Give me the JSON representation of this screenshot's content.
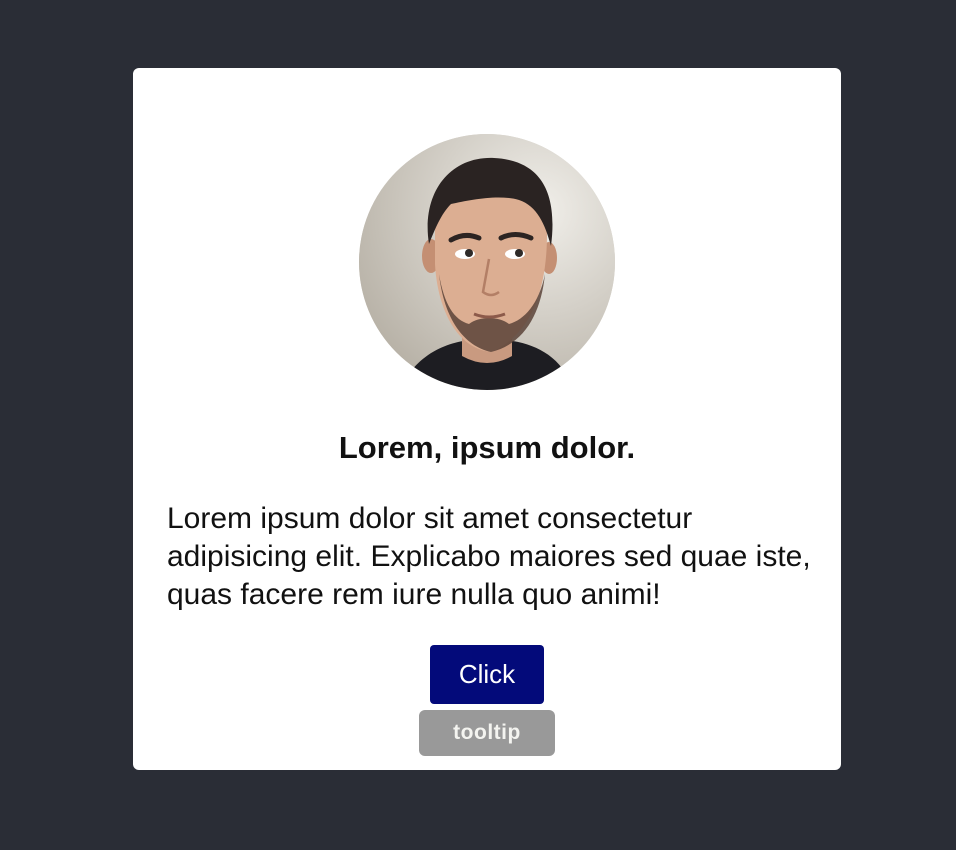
{
  "card": {
    "avatar_icon": "person-portrait",
    "title": "Lorem, ipsum dolor.",
    "description": "Lorem ipsum dolor sit amet consectetur adipisicing elit. Explicabo maiores sed quae iste, quas facere rem iure nulla quo animi!",
    "button_label": "Click",
    "tooltip_text": "tooltip"
  },
  "colors": {
    "page_background": "#2a2d36",
    "card_background": "#ffffff",
    "button_background": "#030a7a",
    "tooltip_background": "#999999"
  }
}
